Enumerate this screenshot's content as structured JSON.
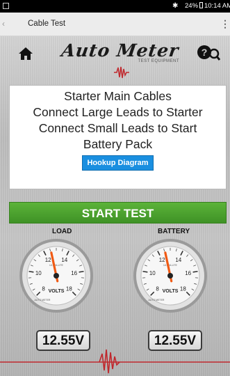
{
  "status_bar": {
    "right_text": "24%",
    "time": "10:14 AM"
  },
  "toolbar": {
    "title": "Cable Test",
    "back_icon": "back-arrow-icon",
    "menu_icon": "more-vertical-icon"
  },
  "header": {
    "logo_text": "Auto Meter",
    "logo_subtitle": "TEST EQUIPMENT",
    "home_icon": "home-icon",
    "help_icon": "help-search-icon"
  },
  "instructions": {
    "title": "Starter Main Cables",
    "line1": "Connect Large Leads to Starter",
    "line2": "Connect Small Leads to Start",
    "line3": "Battery Pack",
    "hookup_label": "Hookup Diagram"
  },
  "start_test_label": "START TEST",
  "gauges": [
    {
      "label": "LOAD",
      "value": 12.55,
      "readout": "12.55V",
      "min": 8,
      "max": 18,
      "ticks": [
        "8",
        "10",
        "12",
        "14",
        "16",
        "18"
      ],
      "unit_text": "VOLTS",
      "brand_text": "AUTO METER",
      "face_text": "ULTRA-LITE"
    },
    {
      "label": "BATTERY",
      "value": 12.55,
      "readout": "12.55V",
      "min": 8,
      "max": 18,
      "ticks": [
        "8",
        "10",
        "12",
        "14",
        "16",
        "18"
      ],
      "unit_text": "VOLTS",
      "brand_text": "AUTO METER",
      "face_text": "ULTRA-LITE"
    }
  ],
  "colors": {
    "accent_green": "#4aa02e",
    "button_blue": "#1a8fe0",
    "needle_orange": "#f05a14",
    "wave_red": "#c0282d"
  }
}
